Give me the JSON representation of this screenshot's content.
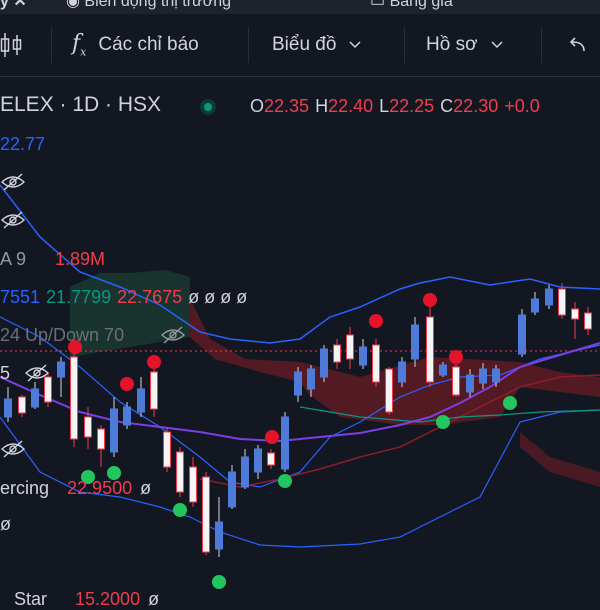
{
  "tabs": [
    "y ✕",
    "Biến động thị trường",
    "Bảng giá"
  ],
  "toolbar": {
    "indicators_label": "Các chỉ báo",
    "chart_label": "Biểu đồ",
    "profile_label": "Hồ sơ"
  },
  "symbol": {
    "title": "ELEX · 1D · HSX",
    "ohlc": [
      {
        "k": "O",
        "v": "22.35"
      },
      {
        "k": "H",
        "v": "22.40"
      },
      {
        "k": "L",
        "v": "22.25"
      },
      {
        "k": "C",
        "v": "22.30"
      }
    ],
    "change": "+0.0"
  },
  "legend": {
    "ma_value": "22.77",
    "vol_label": "A 9",
    "vol_value": "1.89M",
    "bb_v1": "7551",
    "bb_v2": "21.7799",
    "bb_v3": "22.7675",
    "bb_na": "ø ø ø ø",
    "updown_label": "24 Up/Down 70",
    "five": "5",
    "piercing_label": "ercing",
    "piercing_value": "22.9500",
    "piercing_na": "ø",
    "star_label": "Star",
    "star_value": "15.2000",
    "star_na": "ø"
  },
  "colors": {
    "bg": "#131722",
    "up": "#4e7bd9",
    "down": "#f03d4e",
    "ma": "#7b3fe4",
    "band": "#2962ff",
    "green_dot": "#22c55e",
    "red_dot": "#e3132a",
    "teal": "#089981"
  }
}
